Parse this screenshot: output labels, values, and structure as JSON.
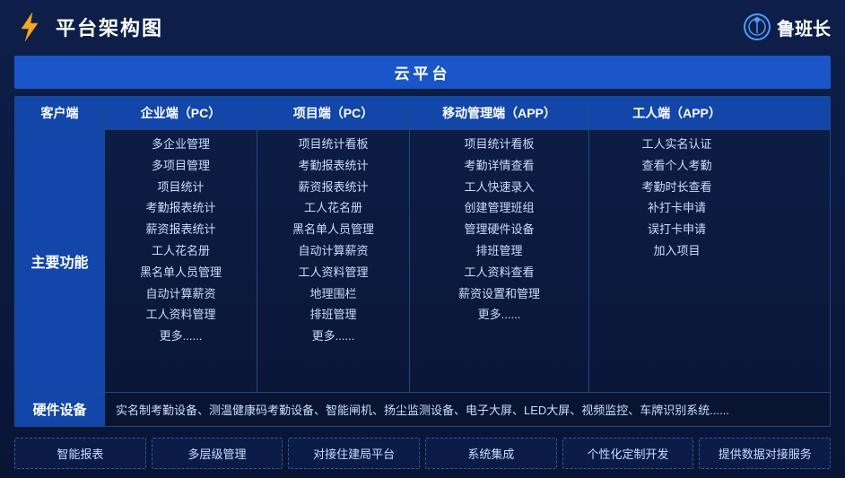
{
  "header": {
    "title": "平台架构图",
    "brand_name": "鲁班长"
  },
  "cloud_platform": {
    "label": "云平台"
  },
  "columns": [
    {
      "id": "client",
      "label": "客户端"
    },
    {
      "id": "enterprise",
      "label": "企业端（PC）"
    },
    {
      "id": "project",
      "label": "项目端（PC）"
    },
    {
      "id": "mobile",
      "label": "移动管理端（APP）"
    },
    {
      "id": "worker",
      "label": "工人端（APP）"
    }
  ],
  "main_label": "主要功能",
  "enterprise_features": [
    "多企业管理",
    "多项目管理",
    "项目统计",
    "考勤报表统计",
    "薪资报表统计",
    "工人花名册",
    "黑名单人员管理",
    "自动计算薪资",
    "工人资料管理",
    "更多......"
  ],
  "project_features": [
    "项目统计看板",
    "考勤报表统计",
    "薪资报表统计",
    "工人花名册",
    "黑名单人员管理",
    "自动计算薪资",
    "工人资料管理",
    "地理围栏",
    "排班管理",
    "更多......"
  ],
  "mobile_features": [
    "项目统计看板",
    "考勤详情查看",
    "工人快速录入",
    "创建管理班组",
    "管理硬件设备",
    "排班管理",
    "工人资料查看",
    "薪资设置和管理",
    "更多......"
  ],
  "worker_features": [
    "工人实名认证",
    "查看个人考勤",
    "考勤时长查看",
    "补打卡申请",
    "误打卡申请",
    "加入项目"
  ],
  "hardware": {
    "label": "硬件设备",
    "content": "实名制考勤设备、测温健康码考勤设备、智能闸机、扬尘监测设备、电子大屏、LED大屏、视频监控、车牌识别系统......"
  },
  "features": [
    "智能报表",
    "多层级管理",
    "对接住建局平台",
    "系统集成",
    "个性化定制开发",
    "提供数据对接服务"
  ]
}
